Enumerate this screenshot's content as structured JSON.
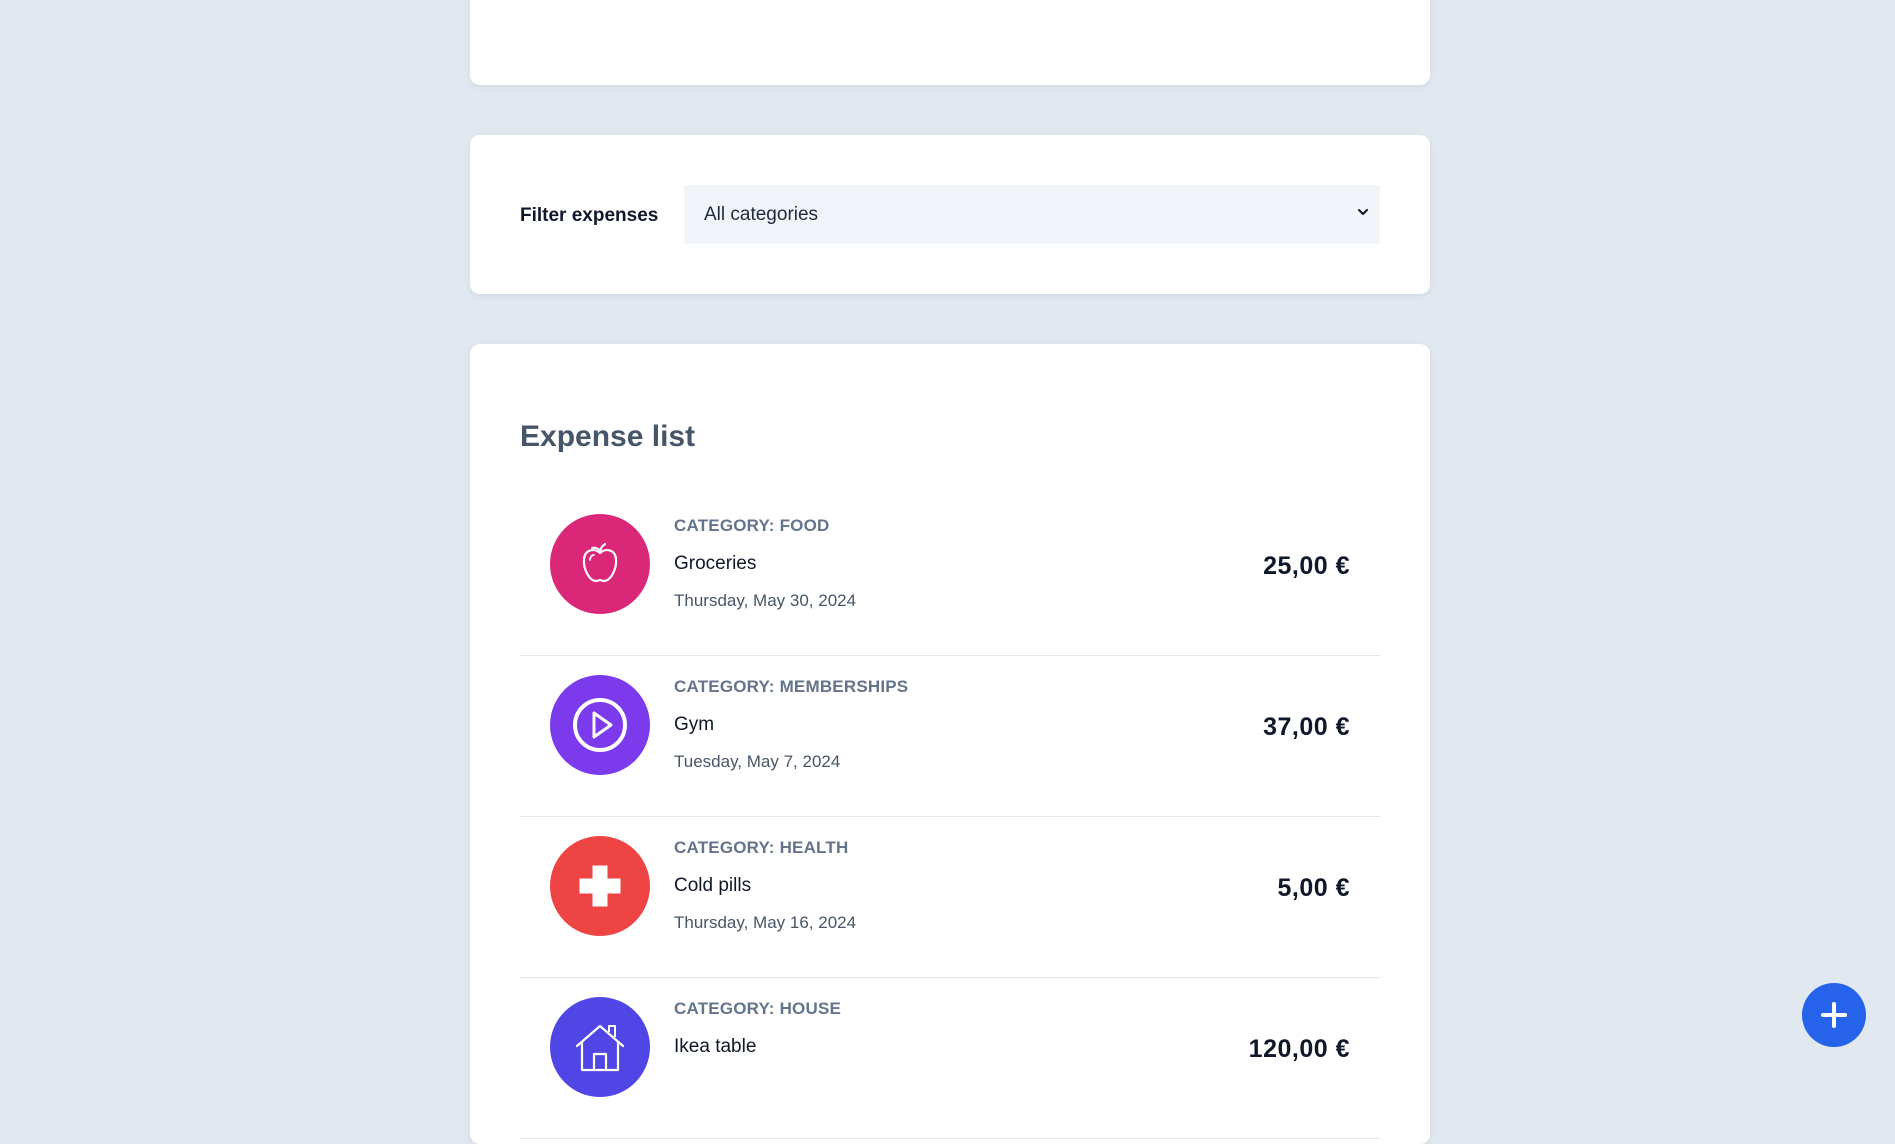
{
  "filter": {
    "label": "Filter expenses",
    "selected": "All categories"
  },
  "expense_list": {
    "title": "Expense list",
    "items": [
      {
        "category": "CATEGORY: FOOD",
        "name": "Groceries",
        "date": "Thursday, May 30, 2024",
        "amount": "25,00 €",
        "icon": "apple-icon",
        "color": "#db2777"
      },
      {
        "category": "CATEGORY: MEMBERSHIPS",
        "name": "Gym",
        "date": "Tuesday, May 7, 2024",
        "amount": "37,00 €",
        "icon": "play-circle-icon",
        "color": "#7c3aed"
      },
      {
        "category": "CATEGORY: HEALTH",
        "name": "Cold pills",
        "date": "Thursday, May 16, 2024",
        "amount": "5,00 €",
        "icon": "medical-cross-icon",
        "color": "#ef4444"
      },
      {
        "category": "CATEGORY: HOUSE",
        "name": "Ikea table",
        "date": "",
        "amount": "120,00 €",
        "icon": "house-icon",
        "color": "#4f46e5"
      }
    ]
  },
  "fab": {
    "icon": "plus-icon",
    "color": "#2563eb"
  }
}
